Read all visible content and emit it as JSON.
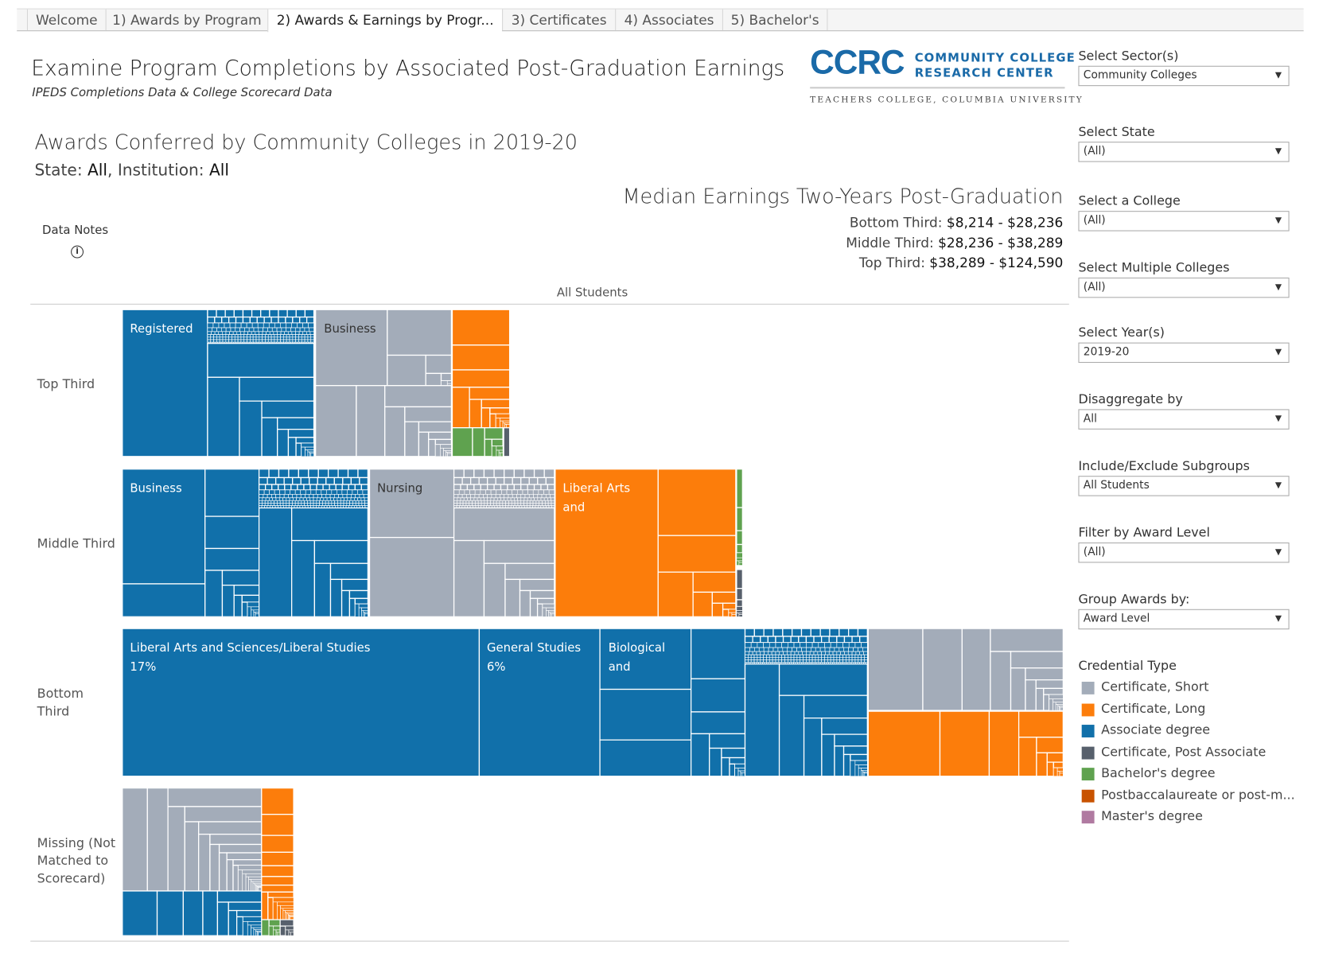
{
  "tabs": [
    {
      "label": "Welcome"
    },
    {
      "label": "1) Awards by Program"
    },
    {
      "label": "2) Awards & Earnings by Progr..."
    },
    {
      "label": "3) Certificates"
    },
    {
      "label": "4) Associates"
    },
    {
      "label": "5) Bachelor's"
    }
  ],
  "header": {
    "title": "Examine Program Completions by Associated Post-Graduation Earnings",
    "subtitle": "IPEDS Completions Data & College Scorecard Data"
  },
  "logo": {
    "mark": "CCRC",
    "line1": "COMMUNITY COLLEGE",
    "line2": "RESEARCH CENTER",
    "line3": "TEACHERS COLLEGE, COLUMBIA UNIVERSITY"
  },
  "main": {
    "heading": "Awards Conferred by Community Colleges in 2019-20",
    "state_label": "State: ",
    "state_value": "All",
    "inst_label": ", Institution: ",
    "inst_value": "All",
    "data_notes": "Data Notes",
    "earnings_title": "Median Earnings Two-Years Post-Graduation",
    "earnings": [
      {
        "label": "Bottom Third: ",
        "range": "$8,214 - $28,236"
      },
      {
        "label": "Middle Third: ",
        "range": "$28,236 - $38,289"
      },
      {
        "label": "Top Third: ",
        "range": "$38,289 - $124,590"
      }
    ],
    "column_header": "All Students"
  },
  "filters": [
    {
      "label": "Select Sector(s)",
      "value": "Community Colleges"
    },
    {
      "label": "Select State",
      "value": "(All)"
    },
    {
      "label": "Select a College",
      "value": "(All)"
    },
    {
      "label": "Select Multiple Colleges",
      "value": "(All)"
    },
    {
      "label": "Select Year(s)",
      "value": "2019-20"
    },
    {
      "label": "Disaggregate by",
      "value": "All"
    },
    {
      "label": "Include/Exclude Subgroups",
      "value": "All Students"
    },
    {
      "label": "Filter by Award Level",
      "value": "(All)"
    },
    {
      "label": "Group Awards by:",
      "value": "Award Level"
    }
  ],
  "legend": {
    "title": "Credential Type",
    "items": [
      {
        "label": "Certificate, Short",
        "color": "#a3acb9"
      },
      {
        "label": "Certificate, Long",
        "color": "#fc7d0b"
      },
      {
        "label": "Associate degree",
        "color": "#1170aa"
      },
      {
        "label": "Certificate, Post Associate",
        "color": "#57606c"
      },
      {
        "label": "Bachelor's degree",
        "color": "#5fa24f"
      },
      {
        "label": "Postbaccalaureate or post-m...",
        "color": "#c85200"
      },
      {
        "label": "Master's degree",
        "color": "#b07aa1"
      }
    ]
  },
  "chart_data": {
    "type": "treemap",
    "rows": [
      {
        "label": "Top Third",
        "labeled_tiles": [
          {
            "label": "Registered",
            "credential": "Associate degree"
          },
          {
            "label": "Business",
            "credential": "Certificate, Short"
          }
        ]
      },
      {
        "label": "Middle Third",
        "labeled_tiles": [
          {
            "label": "Business",
            "credential": "Associate degree"
          },
          {
            "label": "Nursing",
            "credential": "Certificate, Short"
          },
          {
            "label": "Liberal Arts and",
            "credential": "Certificate, Long"
          }
        ]
      },
      {
        "label": "Bottom Third",
        "labeled_tiles": [
          {
            "label": "Liberal Arts and Sciences/Liberal Studies",
            "pct": "17%",
            "credential": "Associate degree"
          },
          {
            "label": "General Studies",
            "pct": "6%",
            "credential": "Associate degree"
          },
          {
            "label": "Biological and",
            "credential": "Associate degree"
          }
        ]
      },
      {
        "label": "Missing (Not Matched to Scorecard)",
        "labeled_tiles": []
      }
    ]
  }
}
